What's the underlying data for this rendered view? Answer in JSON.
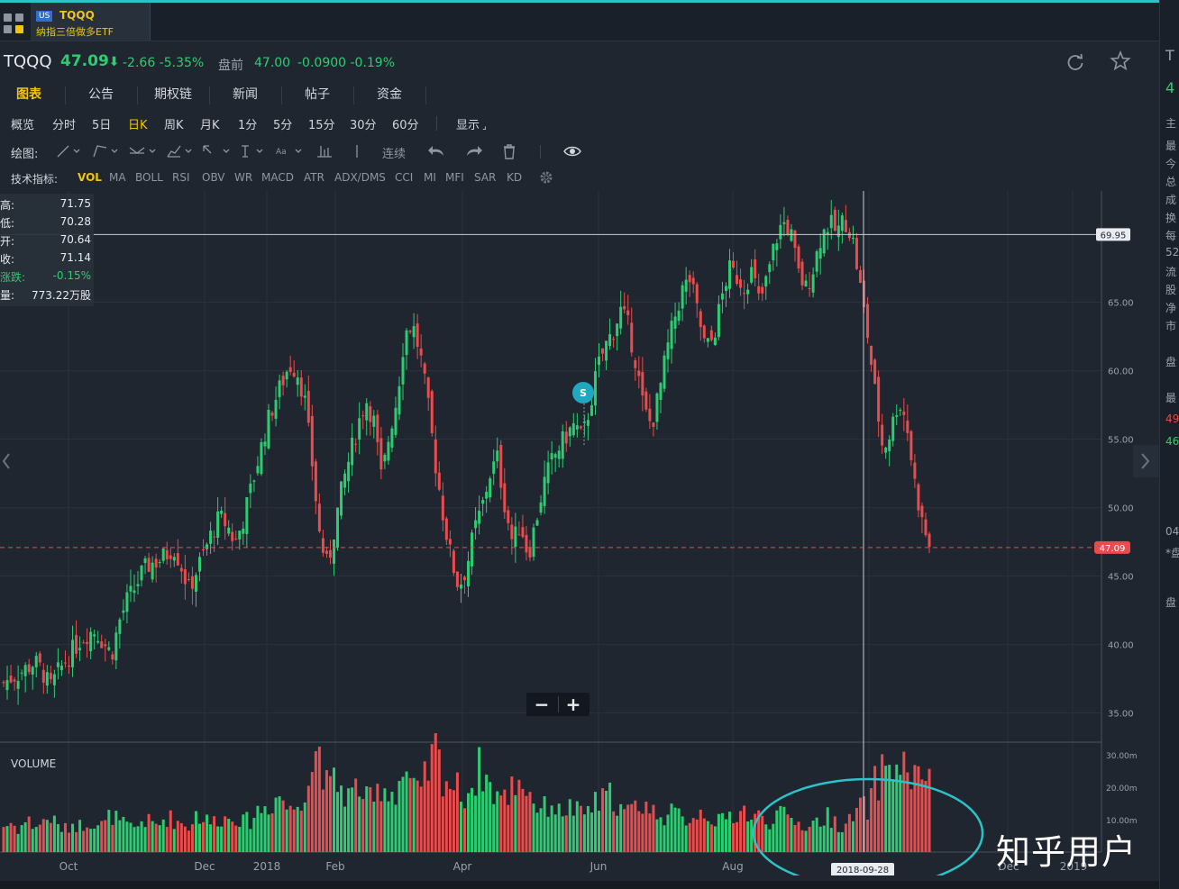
{
  "tab": {
    "market_badge": "US",
    "symbol": "TQQQ",
    "name": "纳指三倍做多ETF"
  },
  "quote": {
    "symbol": "TQQQ",
    "price": "47.09",
    "change": "-2.66 -5.35%",
    "premarket_label": "盘前",
    "premarket_price": "47.00",
    "premarket_change": "-0.0900 -0.19%"
  },
  "nav_tabs": [
    "图表",
    "公告",
    "期权链",
    "新闻",
    "帖子",
    "资金"
  ],
  "periods": [
    "概览",
    "分时",
    "5日",
    "日K",
    "周K",
    "月K",
    "1分",
    "5分",
    "15分",
    "30分",
    "60分"
  ],
  "display_menu": "显示",
  "draw_toolbar": {
    "label": "绘图:",
    "continuous": "连续"
  },
  "indicators": {
    "label": "技术指标:",
    "items": [
      "VOL",
      "MA",
      "BOLL",
      "RSI",
      "OBV",
      "WR",
      "MACD",
      "ATR",
      "ADX/DMS",
      "CCI",
      "MI",
      "MFI",
      "SAR",
      "KD"
    ]
  },
  "ohlc_box": [
    {
      "label": "高:",
      "value": "71.75"
    },
    {
      "label": "低:",
      "value": "70.28"
    },
    {
      "label": "开:",
      "value": "70.64"
    },
    {
      "label": "收:",
      "value": "71.14"
    },
    {
      "label": "涨跌:",
      "value": "-0.15%"
    },
    {
      "label": "量:",
      "value": "773.22万股"
    }
  ],
  "volume_label": "VOLUME",
  "split_marker": "S",
  "right_panel": {
    "text": [
      "T",
      "4",
      "主",
      "最",
      "今",
      "总",
      "成",
      "换",
      "每",
      "52",
      "流",
      "股",
      "净",
      "市",
      "盘",
      "最",
      "49",
      "46",
      "04",
      "*盘",
      "盘"
    ]
  },
  "watermark": "知乎用户",
  "colors": {
    "up": "#2ecc71",
    "down": "#e84c4c",
    "accent": "#f1c40f",
    "annotation": "#2bc3c8"
  },
  "chart_data": {
    "type": "candlestick",
    "price_axis": {
      "ticks": [
        "35.00",
        "40.00",
        "45.00",
        "50.00",
        "55.00",
        "60.00",
        "65.00"
      ],
      "ylim": [
        33.0,
        73.0
      ]
    },
    "volume_axis": {
      "ticks": [
        "10.00m",
        "20.00m",
        "30.00m"
      ],
      "ylim": [
        0,
        33
      ]
    },
    "x_labels": [
      "Oct",
      "Dec",
      "2018",
      "Feb",
      "Apr",
      "Jun",
      "Aug",
      "Dec",
      "2019"
    ],
    "crosshair": {
      "price_label": "69.95",
      "date_label": "2018-09-28"
    },
    "last_price_label": "47.09",
    "close_series": [
      37.2,
      37.6,
      37.9,
      38.3,
      38.7,
      38.1,
      36.8,
      37.9,
      38.8,
      39.6,
      40.4,
      40.9,
      41.0,
      40.1,
      39.3,
      41.7,
      43.2,
      44.1,
      45.3,
      45.9,
      46.1,
      46.5,
      47.2,
      45.8,
      44.0,
      45.4,
      46.7,
      48.2,
      49.3,
      48.7,
      47.4,
      49.0,
      51.2,
      53.5,
      55.8,
      57.6,
      59.0,
      60.4,
      60.1,
      58.0,
      53.2,
      47.8,
      45.6,
      48.9,
      51.8,
      54.0,
      56.2,
      57.9,
      56.3,
      52.0,
      55.4,
      58.0,
      62.8,
      63.4,
      61.2,
      57.5,
      53.1,
      49.4,
      46.3,
      44.2,
      45.6,
      48.3,
      50.0,
      52.4,
      53.6,
      50.1,
      47.4,
      48.9,
      46.5,
      49.0,
      51.7,
      53.3,
      54.4,
      55.3,
      56.1,
      55.0,
      57.4,
      60.2,
      61.8,
      62.9,
      64.4,
      63.2,
      60.5,
      57.1,
      56.0,
      58.4,
      61.5,
      63.9,
      65.9,
      66.7,
      64.1,
      61.6,
      62.4,
      65.1,
      67.4,
      66.9,
      66.2,
      67.3,
      64.9,
      66.8,
      69.4,
      70.9,
      70.2,
      67.1,
      66.0,
      67.6,
      69.9,
      70.8,
      70.1,
      71.1,
      69.8,
      66.3,
      62.6,
      58.2,
      54.2,
      55.6,
      57.9,
      56.4,
      52.2,
      49.1,
      47.1
    ],
    "volume_series_m": [
      8,
      9,
      7,
      10,
      8,
      9,
      11,
      8,
      7,
      9,
      8,
      10,
      9,
      8,
      12,
      9,
      8,
      7,
      10,
      9,
      8,
      11,
      10,
      9,
      8,
      12,
      10,
      9,
      11,
      10,
      12,
      9,
      10,
      13,
      14,
      16,
      18,
      12,
      15,
      20,
      26,
      34,
      18,
      22,
      19,
      17,
      21,
      16,
      15,
      22,
      18,
      20,
      26,
      19,
      17,
      25,
      31,
      24,
      21,
      19,
      18,
      22,
      27,
      20,
      18,
      16,
      21,
      23,
      19,
      15,
      13,
      16,
      12,
      14,
      13,
      11,
      14,
      15,
      16,
      18,
      13,
      12,
      14,
      16,
      12,
      13,
      11,
      12,
      10,
      11,
      12,
      13,
      10,
      9,
      11,
      12,
      13,
      10,
      11,
      9,
      12,
      11,
      10,
      9,
      8,
      9,
      10,
      11,
      9,
      8,
      10,
      14,
      13,
      21,
      25,
      29,
      24,
      27,
      23,
      20,
      30
    ]
  }
}
